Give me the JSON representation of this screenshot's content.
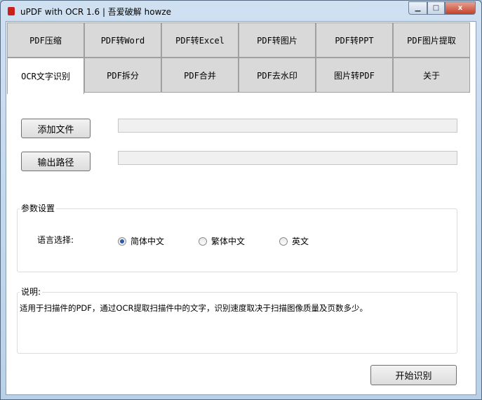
{
  "window": {
    "title": "uPDF with OCR 1.6 | 吾爱破解 howze",
    "minimize": "▁",
    "maximize": "□",
    "close": "x"
  },
  "tabs_row1": [
    "PDF压缩",
    "PDF转Word",
    "PDF转Excel",
    "PDF转图片",
    "PDF转PPT",
    "PDF图片提取"
  ],
  "tabs_row2": [
    "OCR文字识别",
    "PDF拆分",
    "PDF合并",
    "PDF去水印",
    "图片转PDF",
    "关于"
  ],
  "add_file": {
    "label": "添加文件",
    "value": ""
  },
  "output_path": {
    "label": "输出路径",
    "value": ""
  },
  "params": {
    "title": "参数设置",
    "language_label": "语言选择:",
    "options": [
      "简体中文",
      "繁体中文",
      "英文"
    ],
    "selected": 0
  },
  "desc": {
    "title": "说明:",
    "text": "适用于扫描件的PDF，通过OCR提取扫描件中的文字，识别速度取决于扫描图像质量及页数多少。"
  },
  "start_button": "开始识别"
}
